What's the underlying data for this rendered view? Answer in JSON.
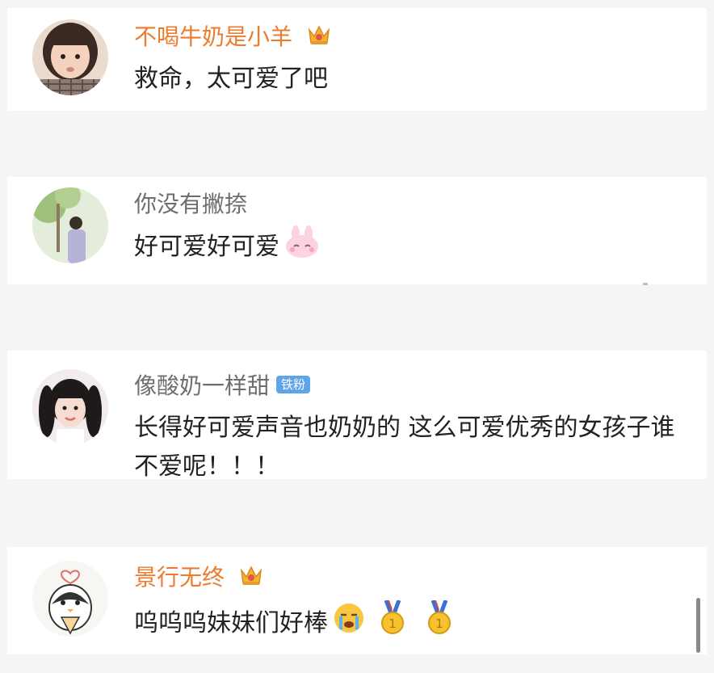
{
  "comments": [
    {
      "username": "不喝牛奶是小羊",
      "text": "救命，太可爱了吧",
      "name_color": "#ee7b2d",
      "has_crown": true
    },
    {
      "username": "你没有撇捺",
      "text": "好可爱好可爱",
      "name_color": "#6e6e6e",
      "emoji": "bunny-face"
    },
    {
      "username": "像酸奶一样甜",
      "badge": "铁粉",
      "text": "长得好可爱声音也奶奶的 这么可爱优秀的女孩子谁不爱呢！！！",
      "name_color": "#6e6e6e"
    },
    {
      "username": "景行无终",
      "text": "呜呜呜妹妹们好棒",
      "name_color": "#ee7b2d",
      "has_crown": true,
      "emojis": [
        "crying-face",
        "gold-medal",
        "gold-medal"
      ]
    }
  ],
  "colors": {
    "background": "#f5f5f5",
    "card": "#ffffff",
    "vip_name": "#ee7b2d",
    "badge": "#5ea4e8"
  }
}
